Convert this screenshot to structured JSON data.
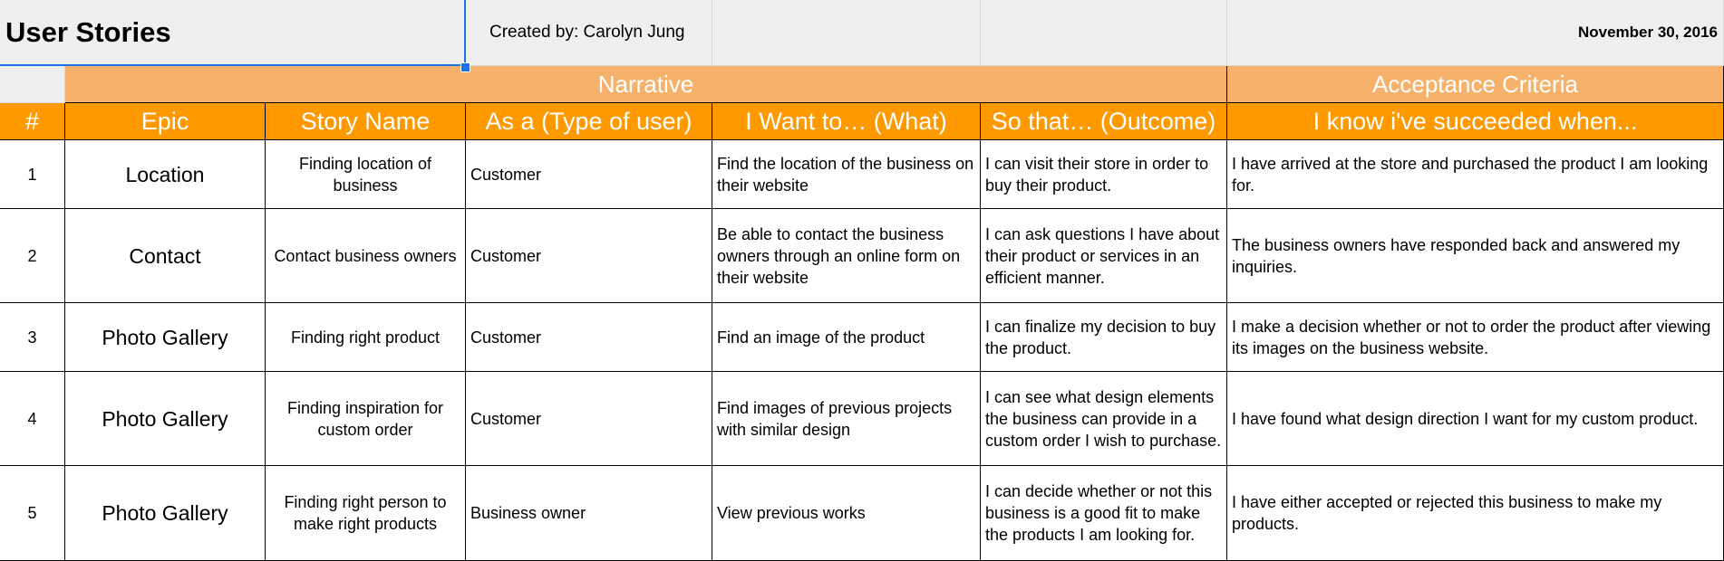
{
  "sheet": {
    "title": "User Stories",
    "created_by": "Created by: Carolyn Jung",
    "date": "November 30, 2016"
  },
  "bands": {
    "narrative": "Narrative",
    "acceptance": "Acceptance Criteria"
  },
  "headers": [
    "#",
    "Epic",
    "Story Name",
    "As a (Type of user)",
    "I Want to… (What)",
    "So that… (Outcome)",
    "I know i've succeeded when..."
  ],
  "rows": [
    {
      "num": "1",
      "epic": "Location",
      "story": "Finding location of business",
      "user": "Customer",
      "want": "Find the location of the business on their website",
      "outcome": "I can visit their store in order to buy their product.",
      "success": "I have arrived at the store and purchased the product I am looking for."
    },
    {
      "num": "2",
      "epic": "Contact",
      "story": "Contact business owners",
      "user": "Customer",
      "want": "Be able to contact the business owners through an online form on their website",
      "outcome": "I can ask questions I have about their product or services in an efficient manner.",
      "success": "The business owners have responded back and answered my inquiries."
    },
    {
      "num": "3",
      "epic": "Photo Gallery",
      "story": "Finding right product",
      "user": "Customer",
      "want": "Find an image of the product",
      "outcome": "I can finalize my decision to buy the product.",
      "success": "I make a decision whether or not to order the product after viewing its images on the business website."
    },
    {
      "num": "4",
      "epic": "Photo Gallery",
      "story": "Finding inspiration for custom order",
      "user": "Customer",
      "want": "Find images of previous projects with similar design",
      "outcome": "I can see what design elements the business can provide in a custom order I wish to purchase.",
      "success": "I have found what design direction I want for my custom product."
    },
    {
      "num": "5",
      "epic": "Photo Gallery",
      "story": "Finding right person to make right products",
      "user": "Business owner",
      "want": "View previous works",
      "outcome": "I can decide whether or not this business is a good fit to make the products I am looking for.",
      "success": "I have either accepted or rejected this business to make my products."
    }
  ],
  "colors": {
    "band": "#f6b26b",
    "header": "#ff9900",
    "selection": "#1a73e8"
  }
}
